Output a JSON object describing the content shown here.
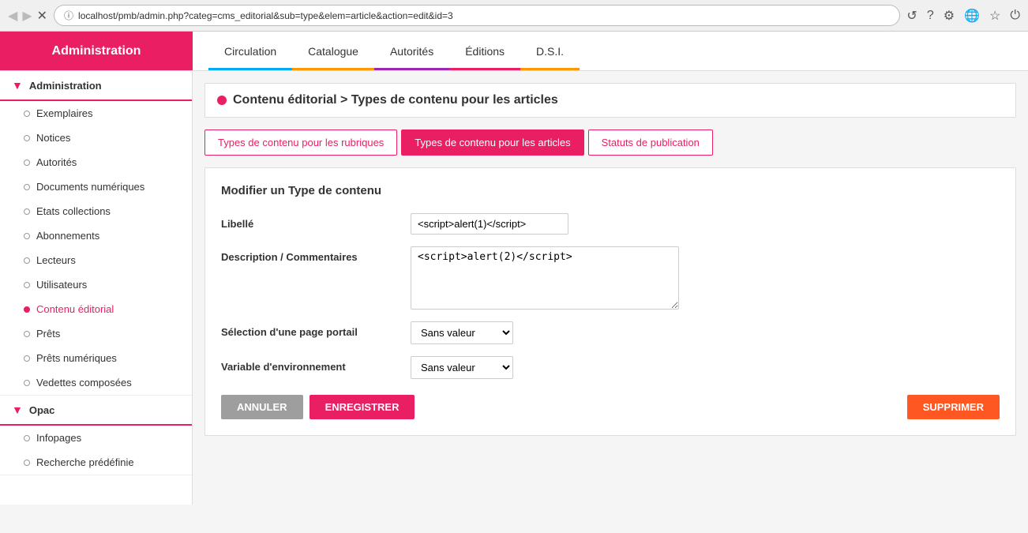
{
  "browser": {
    "url": "localhost/pmb/admin.php?categ=cms_editorial&sub=type&elem=article&action=edit&id=3",
    "back_icon": "◀",
    "forward_icon": "▶",
    "close_icon": "✕",
    "lock_icon": "ⓘ"
  },
  "toolbar_icons": {
    "history": "↺",
    "help": "?",
    "settings": "⚙",
    "globe": "🌐",
    "bookmark": "☆",
    "power": "⏻"
  },
  "top_nav": {
    "admin_label": "Administration",
    "tabs": [
      {
        "id": "circulation",
        "label": "Circulation",
        "class": "circulation"
      },
      {
        "id": "catalogue",
        "label": "Catalogue",
        "class": "catalogue"
      },
      {
        "id": "autorites",
        "label": "Autorités",
        "class": "autorites"
      },
      {
        "id": "editions",
        "label": "Éditions",
        "class": "editions"
      },
      {
        "id": "dsi",
        "label": "D.S.I.",
        "class": "dsi"
      }
    ]
  },
  "sidebar": {
    "section1": {
      "label": "Administration",
      "items": [
        {
          "id": "exemplaires",
          "label": "Exemplaires",
          "active": false
        },
        {
          "id": "notices",
          "label": "Notices",
          "active": false
        },
        {
          "id": "autorites",
          "label": "Autorités",
          "active": false
        },
        {
          "id": "documents-numeriques",
          "label": "Documents numériques",
          "active": false
        },
        {
          "id": "etats-collections",
          "label": "Etats collections",
          "active": false
        },
        {
          "id": "abonnements",
          "label": "Abonnements",
          "active": false
        },
        {
          "id": "lecteurs",
          "label": "Lecteurs",
          "active": false
        },
        {
          "id": "utilisateurs",
          "label": "Utilisateurs",
          "active": false
        },
        {
          "id": "contenu-editorial",
          "label": "Contenu éditorial",
          "active": true
        },
        {
          "id": "prets",
          "label": "Prêts",
          "active": false
        },
        {
          "id": "prets-numeriques",
          "label": "Prêts numériques",
          "active": false
        },
        {
          "id": "vedettes-composees",
          "label": "Vedettes composées",
          "active": false
        }
      ]
    },
    "section2": {
      "label": "Opac",
      "items": [
        {
          "id": "infopages",
          "label": "Infopages",
          "active": false
        },
        {
          "id": "recherche-predifinie",
          "label": "Recherche prédéfinie",
          "active": false
        }
      ]
    }
  },
  "breadcrumb": {
    "text": "Contenu éditorial > Types de contenu pour les articles"
  },
  "tab_buttons": [
    {
      "id": "tab-rubriques",
      "label": "Types de contenu pour les rubriques",
      "active": false
    },
    {
      "id": "tab-articles",
      "label": "Types de contenu pour les articles",
      "active": true
    },
    {
      "id": "tab-statuts",
      "label": "Statuts de publication",
      "active": false
    }
  ],
  "form": {
    "title": "Modifier un Type de contenu",
    "fields": [
      {
        "id": "libelle",
        "label": "Libellé",
        "type": "input",
        "value": "<script>alert(1)</script>"
      },
      {
        "id": "description",
        "label": "Description / Commentaires",
        "type": "textarea",
        "value": "<script>alert(2)</script>"
      },
      {
        "id": "page-portail",
        "label": "Sélection d'une page portail",
        "type": "select",
        "value": "Sans valeur"
      },
      {
        "id": "variable-env",
        "label": "Variable d'environnement",
        "type": "select",
        "value": "Sans valeur"
      }
    ],
    "buttons": {
      "annuler": "ANNULER",
      "enregistrer": "ENREGISTRER",
      "supprimer": "SUPPRIMER"
    }
  }
}
